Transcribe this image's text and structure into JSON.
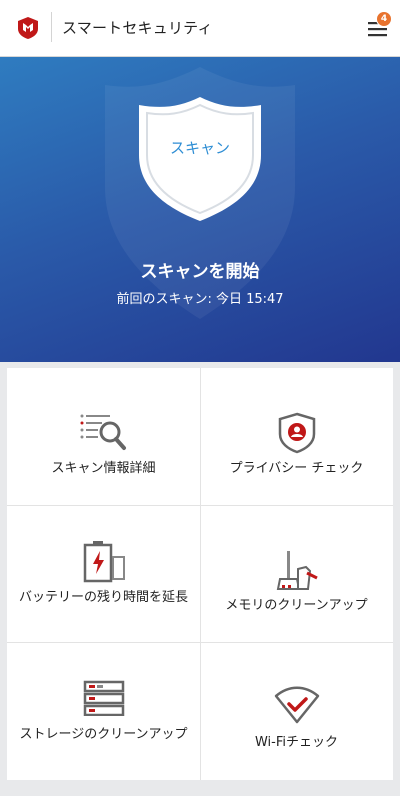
{
  "header": {
    "title": "スマートセキュリティ",
    "notification_count": "4",
    "logo_icon": "mcafee-shield-logo",
    "menu_icon": "hamburger-menu-icon"
  },
  "hero": {
    "shield_label": "スキャン",
    "title": "スキャンを開始",
    "last_scan": "前回のスキャン: 今日 15:47"
  },
  "tiles": [
    {
      "label": "スキャン情報詳細",
      "icon": "scan-details-icon"
    },
    {
      "label": "プライバシー チェック",
      "icon": "privacy-shield-icon"
    },
    {
      "label": "バッテリーの残り時間を延長",
      "icon": "battery-icon"
    },
    {
      "label": "メモリのクリーンアップ",
      "icon": "broom-icon"
    },
    {
      "label": "ストレージのクリーンアップ",
      "icon": "storage-icon"
    },
    {
      "label": "Wi-Fiチェック",
      "icon": "wifi-check-icon"
    }
  ],
  "colors": {
    "brand_red": "#c01818",
    "hero_blue_top": "#2f7cc0",
    "hero_blue_bottom": "#22378f",
    "badge_orange": "#e8732e"
  }
}
